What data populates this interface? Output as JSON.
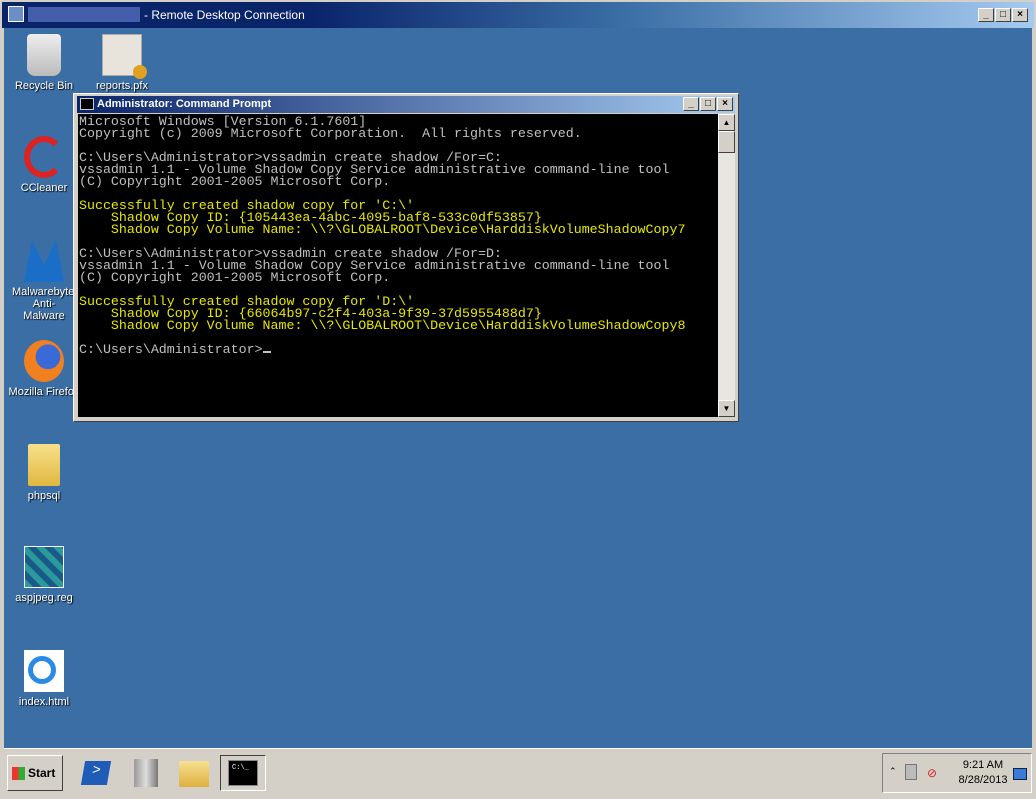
{
  "rdp_window": {
    "title": "- Remote Desktop Connection",
    "buttons": [
      "_",
      "□",
      "×"
    ]
  },
  "desktop_icons": [
    {
      "label": "Recycle Bin",
      "icon": "recycle-bin-icon"
    },
    {
      "label": "reports.pfx",
      "icon": "certificate-key-icon"
    },
    {
      "label": "CCleaner",
      "icon": "ccleaner-icon"
    },
    {
      "label": "Malwarebytes Anti-Malware",
      "icon": "malwarebytes-icon"
    },
    {
      "label": "Mozilla Firefox",
      "icon": "firefox-icon"
    },
    {
      "label": "phpsql",
      "icon": "folder-icon"
    },
    {
      "label": "aspjpeg.reg",
      "icon": "registry-file-icon"
    },
    {
      "label": "index.html",
      "icon": "ie-html-icon"
    }
  ],
  "cmd_window": {
    "title": "Administrator: Command Prompt",
    "lines": [
      {
        "text": "Microsoft Windows [Version 6.1.7601]",
        "color": "#c0c0c0"
      },
      {
        "text": "Copyright (c) 2009 Microsoft Corporation.  All rights reserved.",
        "color": "#c0c0c0"
      },
      {
        "text": "",
        "color": "#c0c0c0"
      },
      {
        "text": "C:\\Users\\Administrator>vssadmin create shadow /For=C:",
        "color": "#c0c0c0"
      },
      {
        "text": "vssadmin 1.1 - Volume Shadow Copy Service administrative command-line tool",
        "color": "#c0c0c0"
      },
      {
        "text": "(C) Copyright 2001-2005 Microsoft Corp.",
        "color": "#c0c0c0"
      },
      {
        "text": "",
        "color": "#c0c0c0"
      },
      {
        "text": "Successfully created shadow copy for 'C:\\'",
        "color": "#e8e800"
      },
      {
        "text": "    Shadow Copy ID: {105443ea-4abc-4095-baf8-533c0df53857}",
        "color": "#e8e800"
      },
      {
        "text": "    Shadow Copy Volume Name: \\\\?\\GLOBALROOT\\Device\\HarddiskVolumeShadowCopy7",
        "color": "#e8e800"
      },
      {
        "text": "",
        "color": "#c0c0c0"
      },
      {
        "text": "C:\\Users\\Administrator>vssadmin create shadow /For=D:",
        "color": "#c0c0c0"
      },
      {
        "text": "vssadmin 1.1 - Volume Shadow Copy Service administrative command-line tool",
        "color": "#c0c0c0"
      },
      {
        "text": "(C) Copyright 2001-2005 Microsoft Corp.",
        "color": "#c0c0c0"
      },
      {
        "text": "",
        "color": "#c0c0c0"
      },
      {
        "text": "Successfully created shadow copy for 'D:\\'",
        "color": "#e8e800"
      },
      {
        "text": "    Shadow Copy ID: {66064b97-c2f4-403a-9f39-37d5955488d7}",
        "color": "#e8e800"
      },
      {
        "text": "    Shadow Copy Volume Name: \\\\?\\GLOBALROOT\\Device\\HarddiskVolumeShadowCopy8",
        "color": "#e8e800"
      },
      {
        "text": "",
        "color": "#c0c0c0"
      }
    ],
    "prompt": "C:\\Users\\Administrator>"
  },
  "taskbar": {
    "start_label": "Start",
    "apps": [
      "powershell-icon",
      "server-manager-icon",
      "explorer-icon",
      "command-prompt-icon"
    ],
    "clock_time": "9:21 AM",
    "clock_date": "8/28/2013"
  }
}
